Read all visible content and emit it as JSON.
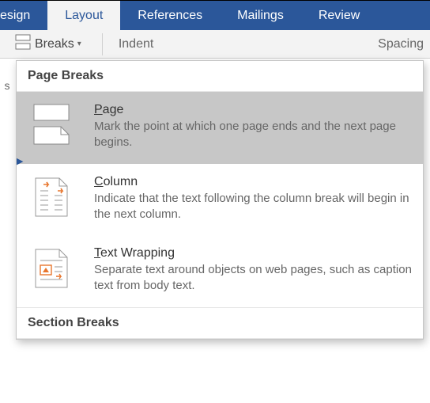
{
  "tabs": {
    "design": "esign",
    "layout": "Layout",
    "references": "References",
    "mailings": "Mailings",
    "review": "Review"
  },
  "ribbon": {
    "breaks_label": "Breaks",
    "indent_label": "Indent",
    "spacing_label": "Spacing"
  },
  "left_partial": "s",
  "dropdown": {
    "header1": "Page Breaks",
    "header2": "Section Breaks",
    "items": [
      {
        "title_u": "P",
        "title_rest": "age",
        "desc": "Mark the point at which one page ends and the next page begins."
      },
      {
        "title_u": "C",
        "title_rest": "olumn",
        "desc": "Indicate that the text following the column break will begin in the next column."
      },
      {
        "title_u": "T",
        "title_rest": "ext Wrapping",
        "desc": "Separate text around objects on web pages, such as caption text from body text."
      }
    ]
  }
}
